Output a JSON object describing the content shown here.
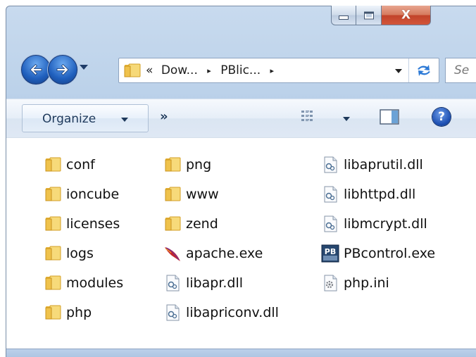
{
  "window": {
    "close_glyph": "X"
  },
  "address_bar": {
    "overflow_marker": "«",
    "crumbs": [
      "Dow...",
      "PBlic..."
    ],
    "separator": "▸",
    "search_placeholder": "Se"
  },
  "toolbar": {
    "organize_label": "Organize",
    "more_label": "»",
    "help_label": "?"
  },
  "files": {
    "col1": [
      {
        "name": "conf",
        "icon": "folder-icon"
      },
      {
        "name": "ioncube",
        "icon": "folder-icon"
      },
      {
        "name": "licenses",
        "icon": "folder-icon"
      },
      {
        "name": "logs",
        "icon": "folder-icon"
      },
      {
        "name": "modules",
        "icon": "folder-icon"
      },
      {
        "name": "php",
        "icon": "folder-icon"
      }
    ],
    "col2": [
      {
        "name": "png",
        "icon": "folder-icon"
      },
      {
        "name": "www",
        "icon": "folder-icon"
      },
      {
        "name": "zend",
        "icon": "folder-icon"
      },
      {
        "name": "apache.exe",
        "icon": "apache-feather-icon"
      },
      {
        "name": "libapr.dll",
        "icon": "dll-file-icon"
      },
      {
        "name": "libapriconv.dll",
        "icon": "dll-file-icon"
      }
    ],
    "col3": [
      {
        "name": "libaprutil.dll",
        "icon": "dll-file-icon"
      },
      {
        "name": "libhttpd.dll",
        "icon": "dll-file-icon"
      },
      {
        "name": "libmcrypt.dll",
        "icon": "dll-file-icon"
      },
      {
        "name": "PBcontrol.exe",
        "icon": "pb-app-icon"
      },
      {
        "name": "php.ini",
        "icon": "ini-file-icon"
      }
    ]
  }
}
